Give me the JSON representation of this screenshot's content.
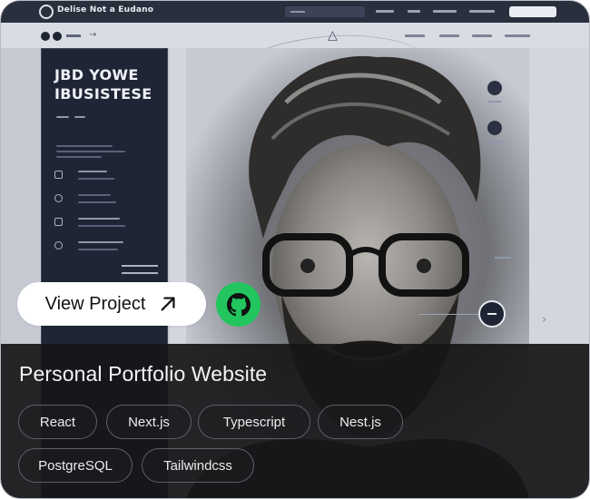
{
  "preview": {
    "site_brand": "Delise Not a Eudano",
    "hero_heading_line1": "JBD YOWE",
    "hero_heading_line2": "IBUSISTESE"
  },
  "card": {
    "view_project_label": "View Project",
    "view_project_icon": "arrow-up-right-icon",
    "github_icon": "github-icon",
    "github_color": "#22c55e",
    "title": "Personal Portfolio Website",
    "tags": [
      "React",
      "Next.js",
      "Typescript",
      "Nest.js",
      "PostgreSQL",
      "Tailwindcss"
    ]
  }
}
